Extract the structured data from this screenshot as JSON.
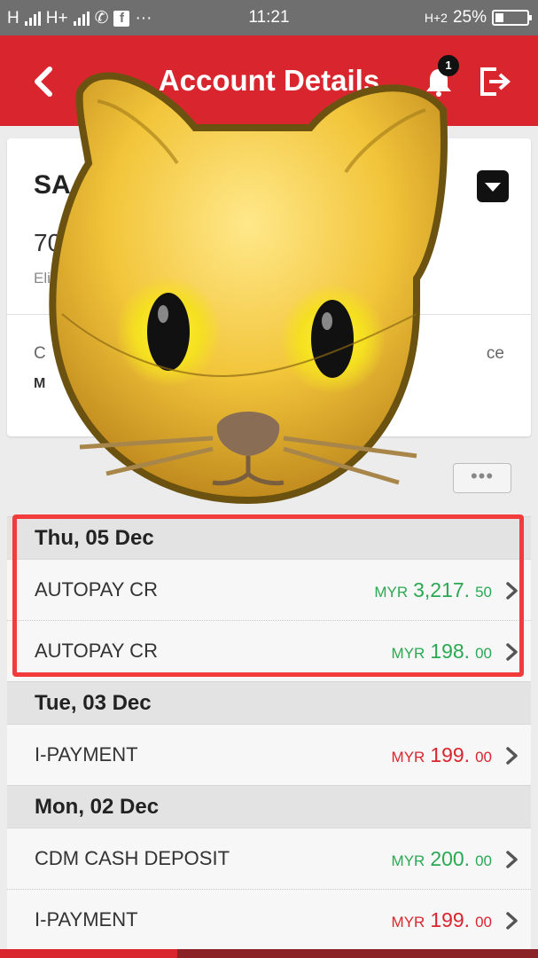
{
  "status_bar": {
    "network_left": "H",
    "network_right": "H+",
    "time": "11:21",
    "network_data": "H+2",
    "battery": "25%"
  },
  "header": {
    "title": "Account Details",
    "notification_count": "1",
    "color": "#d9262e"
  },
  "account": {
    "name_partial": "SA",
    "number_partial": "70 1",
    "eligible_partial": "Elig",
    "left_label_partial": "C",
    "right_label_partial": "ce",
    "currency_partial": "M"
  },
  "more_button": "•••",
  "transactions": [
    {
      "date": "Thu, 05 Dec",
      "items": [
        {
          "description": "AUTOPAY CR",
          "currency": "MYR",
          "whole": "3,217.",
          "cents": "50",
          "type": "credit"
        },
        {
          "description": "AUTOPAY CR",
          "currency": "MYR",
          "whole": "198.",
          "cents": "00",
          "type": "credit"
        }
      ]
    },
    {
      "date": "Tue, 03 Dec",
      "items": [
        {
          "description": "I-PAYMENT",
          "currency": "MYR",
          "whole": "199.",
          "cents": "00",
          "type": "debit"
        }
      ]
    },
    {
      "date": "Mon, 02 Dec",
      "items": [
        {
          "description": "CDM CASH DEPOSIT",
          "currency": "MYR",
          "whole": "200.",
          "cents": "00",
          "type": "credit"
        },
        {
          "description": "I-PAYMENT",
          "currency": "MYR",
          "whole": "199.",
          "cents": "00",
          "type": "debit"
        }
      ]
    }
  ],
  "icons": {
    "overlay": "cat-face-emoji",
    "back": "chevron-left-icon",
    "bell": "bell-icon",
    "logout": "logout-icon",
    "row_chevron": "chevron-right-icon"
  },
  "colors": {
    "credit": "#2aa852",
    "debit": "#d9262e",
    "highlight": "#f23b3b"
  }
}
